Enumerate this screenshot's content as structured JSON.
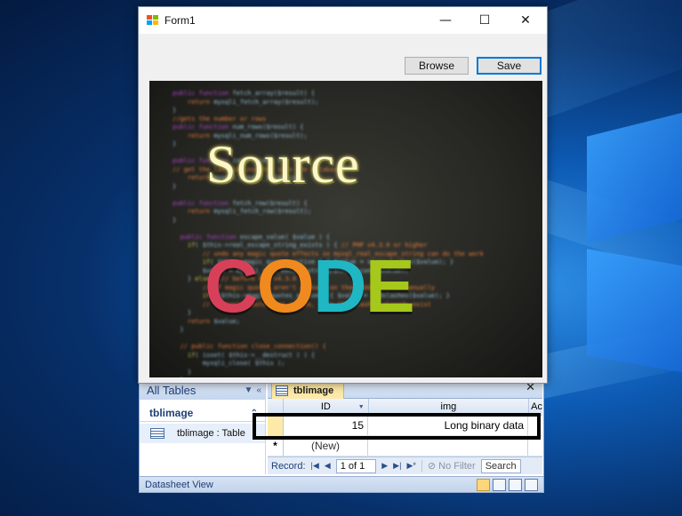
{
  "form": {
    "title": "Form1",
    "browse_label": "Browse",
    "save_label": "Save",
    "picture": {
      "word1": "Source",
      "word2_letters": [
        "C",
        "O",
        "D",
        "E"
      ],
      "word2_colors": [
        "#d8405a",
        "#f08a1e",
        "#1fb7c4",
        "#a6c81a"
      ]
    }
  },
  "access": {
    "nav_header": "All Tables",
    "nav_group": "tblimage",
    "nav_item": "tblimage : Table",
    "doc_tab": "tblimage",
    "columns": [
      "ID",
      "img",
      "Ac"
    ],
    "rows": [
      {
        "id": "15",
        "img": "Long binary data"
      }
    ],
    "new_row_marker": "*",
    "new_row_label": "(New)",
    "record_label": "Record:",
    "record_count": "1 of 1",
    "no_filter_label": "No Filter",
    "search_label": "Search",
    "status": "Datasheet View"
  }
}
